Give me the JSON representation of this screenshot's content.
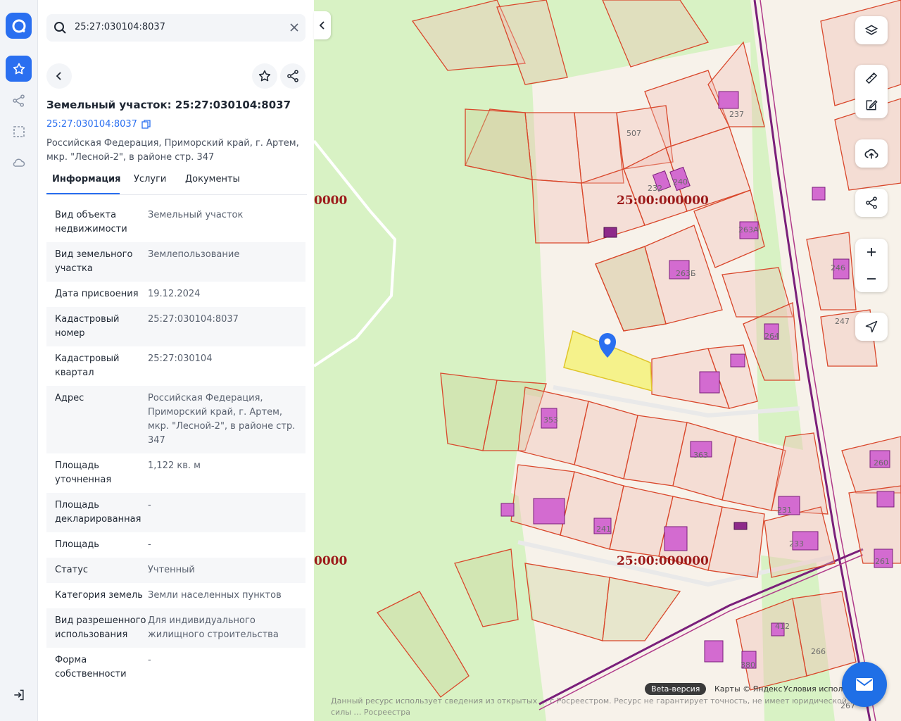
{
  "search": {
    "query": "25:27:030104:8037"
  },
  "object": {
    "title": "Земельный участок: 25:27:030104:8037",
    "cad_link": "25:27:030104:8037",
    "address": "Российская Федерация, Приморский край, г. Артем, мкр. \"Лесной-2\", в районе стр. 347"
  },
  "tabs": [
    "Информация",
    "Услуги",
    "Документы"
  ],
  "info": [
    {
      "k": "Вид объекта недвижимости",
      "v": "Земельный участок"
    },
    {
      "k": "Вид земельного участка",
      "v": "Землепользование"
    },
    {
      "k": "Дата присвоения",
      "v": "19.12.2024"
    },
    {
      "k": "Кадастровый номер",
      "v": "25:27:030104:8037"
    },
    {
      "k": "Кадастровый квартал",
      "v": "25:27:030104"
    },
    {
      "k": "Адрес",
      "v": "Российская Федерация, Приморский край, г. Артем, мкр. \"Лесной-2\", в районе стр. 347"
    },
    {
      "k": "Площадь уточненная",
      "v": "1,122 кв. м"
    },
    {
      "k": "Площадь декларированная",
      "v": "-"
    },
    {
      "k": "Площадь",
      "v": "-"
    },
    {
      "k": "Статус",
      "v": "Учтенный"
    },
    {
      "k": "Категория земель",
      "v": "Земли населенных пунктов"
    },
    {
      "k": "Вид разрешенного использования",
      "v": "Для индивидуального жилищного строительства"
    },
    {
      "k": "Форма собственности",
      "v": "-"
    }
  ],
  "map": {
    "quarter_labels": [
      "25:00:000000",
      "25:00:000000",
      "0000",
      "0000"
    ],
    "lot_labels": [
      "507",
      "237",
      "232",
      "240",
      "263А",
      "263Б",
      "246",
      "247",
      "264",
      "353",
      "363",
      "231",
      "233",
      "241",
      "260",
      "261",
      "412",
      "266",
      "380",
      "267"
    ],
    "footer": {
      "beta": "Beta-версия",
      "attribution": "Карты © Яндекс",
      "terms": "Условия испол",
      "disclaimer": "Данный ресурс использует сведения из открытых … с Росреестром. Ресурс не гарантирует точность, не имеет юридической силы … Росреестра"
    }
  },
  "colors": {
    "accent": "#2a6ff0",
    "parcel_border": "#d9472b",
    "highlight": "#f5f27a",
    "forest": "#d8f2c4"
  }
}
